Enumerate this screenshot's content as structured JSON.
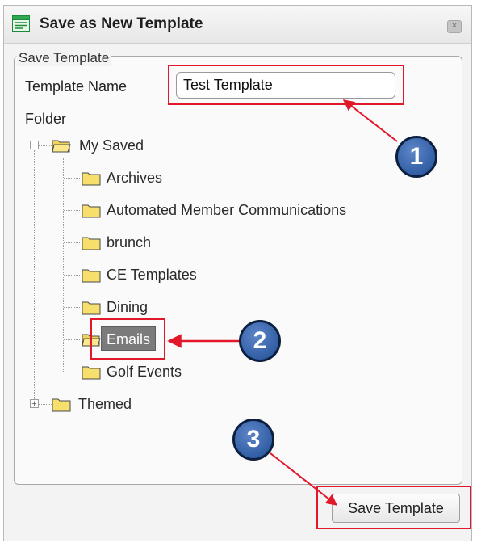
{
  "dialog": {
    "title": "Save as New Template",
    "close_symbol": "×",
    "icons": {
      "app": "template-window-icon",
      "close": "close-icon"
    }
  },
  "form": {
    "legend": "Save Template",
    "template_name_label": "Template Name",
    "template_name_value": "Test Template",
    "folder_label": "Folder"
  },
  "tree": {
    "root": {
      "label": "My Saved",
      "expander": "−"
    },
    "children": [
      {
        "label": "Archives"
      },
      {
        "label": "Automated Member Communications"
      },
      {
        "label": "brunch"
      },
      {
        "label": "CE Templates"
      },
      {
        "label": "Dining"
      },
      {
        "label": "Emails",
        "selected": true
      },
      {
        "label": "Golf Events"
      }
    ],
    "themed": {
      "label": "Themed",
      "expander": "+"
    }
  },
  "actions": {
    "save_label": "Save Template"
  },
  "callouts": [
    "1",
    "2",
    "3"
  ],
  "colors": {
    "highlight": "#e3172a",
    "callout": "#2b5ba8",
    "selected_bg": "#7b7b7b"
  }
}
